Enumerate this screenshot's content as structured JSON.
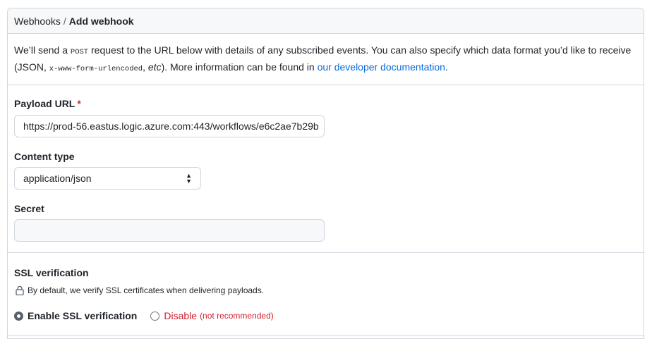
{
  "breadcrumb": {
    "parent": "Webhooks",
    "separator": "/",
    "current": "Add webhook"
  },
  "intro": {
    "part1": "We’ll send a ",
    "code_post": "POST",
    "part2": " request to the URL below with details of any subscribed events. You can also specify which data format you’d like to receive (JSON, ",
    "code_form": "x-www-form-urlencoded",
    "part3": ", ",
    "etc": "etc",
    "part4": "). More information can be found in ",
    "link": "our developer documentation",
    "part5": "."
  },
  "payload_url": {
    "label": "Payload URL",
    "required_mark": "*",
    "value": "https://prod-56.eastus.logic.azure.com:443/workflows/e6c2ae7b29b"
  },
  "content_type": {
    "label": "Content type",
    "selected": "application/json"
  },
  "secret": {
    "label": "Secret",
    "value": ""
  },
  "ssl": {
    "title": "SSL verification",
    "note": "By default, we verify SSL certificates when delivering payloads.",
    "enable_label": "Enable SSL verification",
    "disable_label": "Disable",
    "disable_note": "(not recommended)",
    "selected": "enable"
  },
  "colors": {
    "border": "#d0d7de",
    "header_bg": "#f6f8fa",
    "link": "#0969da",
    "danger": "#cf222e"
  }
}
